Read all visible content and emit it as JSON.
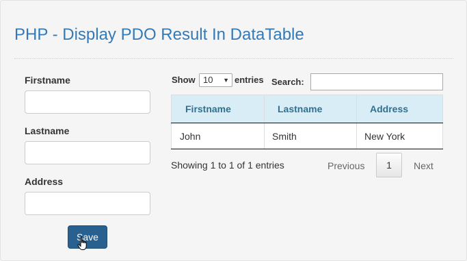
{
  "page": {
    "title": "PHP - Display PDO Result In DataTable"
  },
  "form": {
    "firstname_label": "Firstname",
    "firstname_value": "",
    "lastname_label": "Lastname",
    "lastname_value": "",
    "address_label": "Address",
    "address_value": "",
    "save_label": "Save"
  },
  "datatable": {
    "show_label": "Show",
    "page_length": "10",
    "entries_label": "entries",
    "search_label": "Search:",
    "search_value": "",
    "columns": [
      "Firstname",
      "Lastname",
      "Address"
    ],
    "rows": [
      [
        "John",
        "Smith",
        "New York"
      ]
    ],
    "info": "Showing 1 to 1 of 1 entries",
    "pagination": {
      "previous": "Previous",
      "current_page": "1",
      "next": "Next"
    }
  },
  "colors": {
    "title": "#337ab7",
    "header_bg": "#d9edf7",
    "header_text": "#31708f",
    "save_button": "#286090"
  },
  "icons": {
    "cursor": "hand-pointer-icon",
    "select_caret": "caret-down-icon"
  }
}
